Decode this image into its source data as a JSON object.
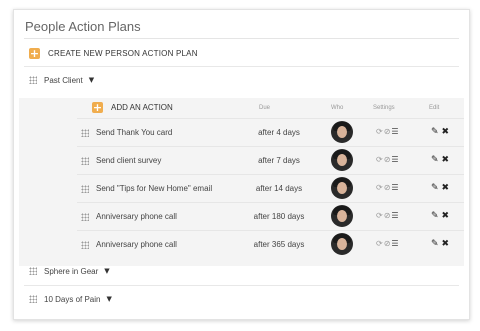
{
  "panel": {
    "title": "People Action Plans"
  },
  "create": {
    "icon": "plus-icon",
    "label": "CREATE NEW PERSON ACTION PLAN"
  },
  "groups": [
    {
      "label": "Past Client"
    },
    {
      "label": "Sphere in Gear"
    },
    {
      "label": "10 Days of Pain"
    }
  ],
  "actions_table": {
    "add_label": "ADD AN ACTION",
    "headers": {
      "due": "Due",
      "who": "Who",
      "settings": "Settings",
      "edit": "Edit"
    },
    "rows": [
      {
        "name": "Send Thank You card",
        "due": "after 4 days"
      },
      {
        "name": "Send client survey",
        "due": "after 7 days"
      },
      {
        "name": "Send \"Tips for New Home\" email",
        "due": "after 14 days"
      },
      {
        "name": "Anniversary phone call",
        "due": "after 180 days"
      },
      {
        "name": "Anniversary phone call",
        "due": "after 365 days"
      }
    ]
  },
  "icons": {
    "settings": [
      "repeat-icon",
      "hidden-eye-icon",
      "list-icon"
    ],
    "edit": [
      "pencil-icon",
      "delete-x-icon"
    ]
  },
  "colors": {
    "accent": "#f0ad4e",
    "block_bg": "#f4f4f4"
  }
}
